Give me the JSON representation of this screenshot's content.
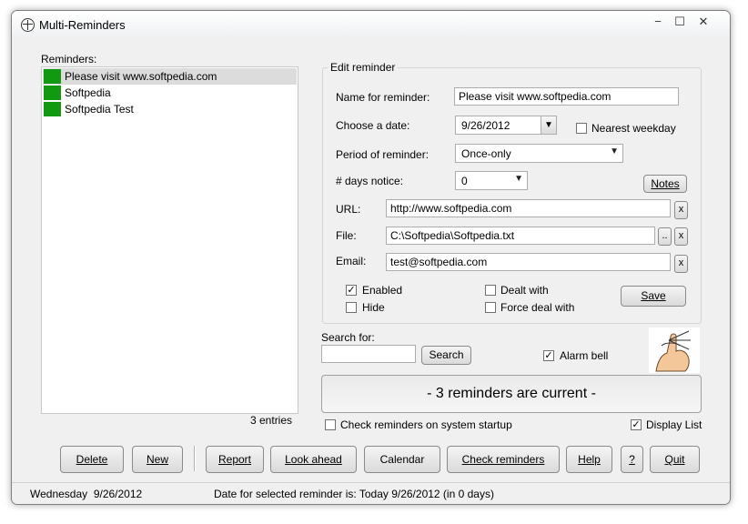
{
  "window": {
    "title": "Multi-Reminders",
    "min": "−",
    "max": "☐",
    "close": "✕"
  },
  "reminders": {
    "label": "Reminders:",
    "items": [
      {
        "label": "Please visit www.softpedia.com",
        "color": "#119911"
      },
      {
        "label": "Softpedia",
        "color": "#119911"
      },
      {
        "label": "Softpedia Test",
        "color": "#119911"
      }
    ],
    "count_text": "3 entries"
  },
  "edit": {
    "group_title": "Edit reminder",
    "name_label": "Name for reminder:",
    "name_value": "Please visit www.softpedia.com",
    "date_label": "Choose a date:",
    "date_value": "9/26/2012",
    "nearest_weekday_label": "Nearest weekday",
    "period_label": "Period of reminder:",
    "period_value": "Once-only",
    "days_label": "# days notice:",
    "days_value": "0",
    "notes_label": "Notes",
    "url_label": "URL:",
    "url_value": "http://www.softpedia.com",
    "file_label": "File:",
    "file_value": "C:\\Softpedia\\Softpedia.txt",
    "browse_label": "..",
    "email_label": "Email:",
    "email_value": "test@softpedia.com",
    "clear_label": "x",
    "enabled_label": "Enabled",
    "hide_label": "Hide",
    "dealt_label": "Dealt with",
    "force_label": "Force deal with",
    "save_label": "Save",
    "check_mark": "✓"
  },
  "search": {
    "label": "Search for:",
    "value": "",
    "button": "Search"
  },
  "alarm_bell_label": "Alarm bell",
  "status_message": "- 3 reminders are current -",
  "check_startup_label": "Check reminders on system startup",
  "display_list_label": "Display List",
  "buttons": {
    "delete": "Delete",
    "new": "New",
    "report": "Report",
    "look_ahead": "Look ahead",
    "calendar": "Calendar",
    "check_reminders": "Check reminders",
    "help": "Help",
    "question": "?",
    "quit": "Quit"
  },
  "statusbar": {
    "date": "Wednesday  9/26/2012",
    "selected": "Date for selected reminder is: Today 9/26/2012 (in 0 days)"
  }
}
